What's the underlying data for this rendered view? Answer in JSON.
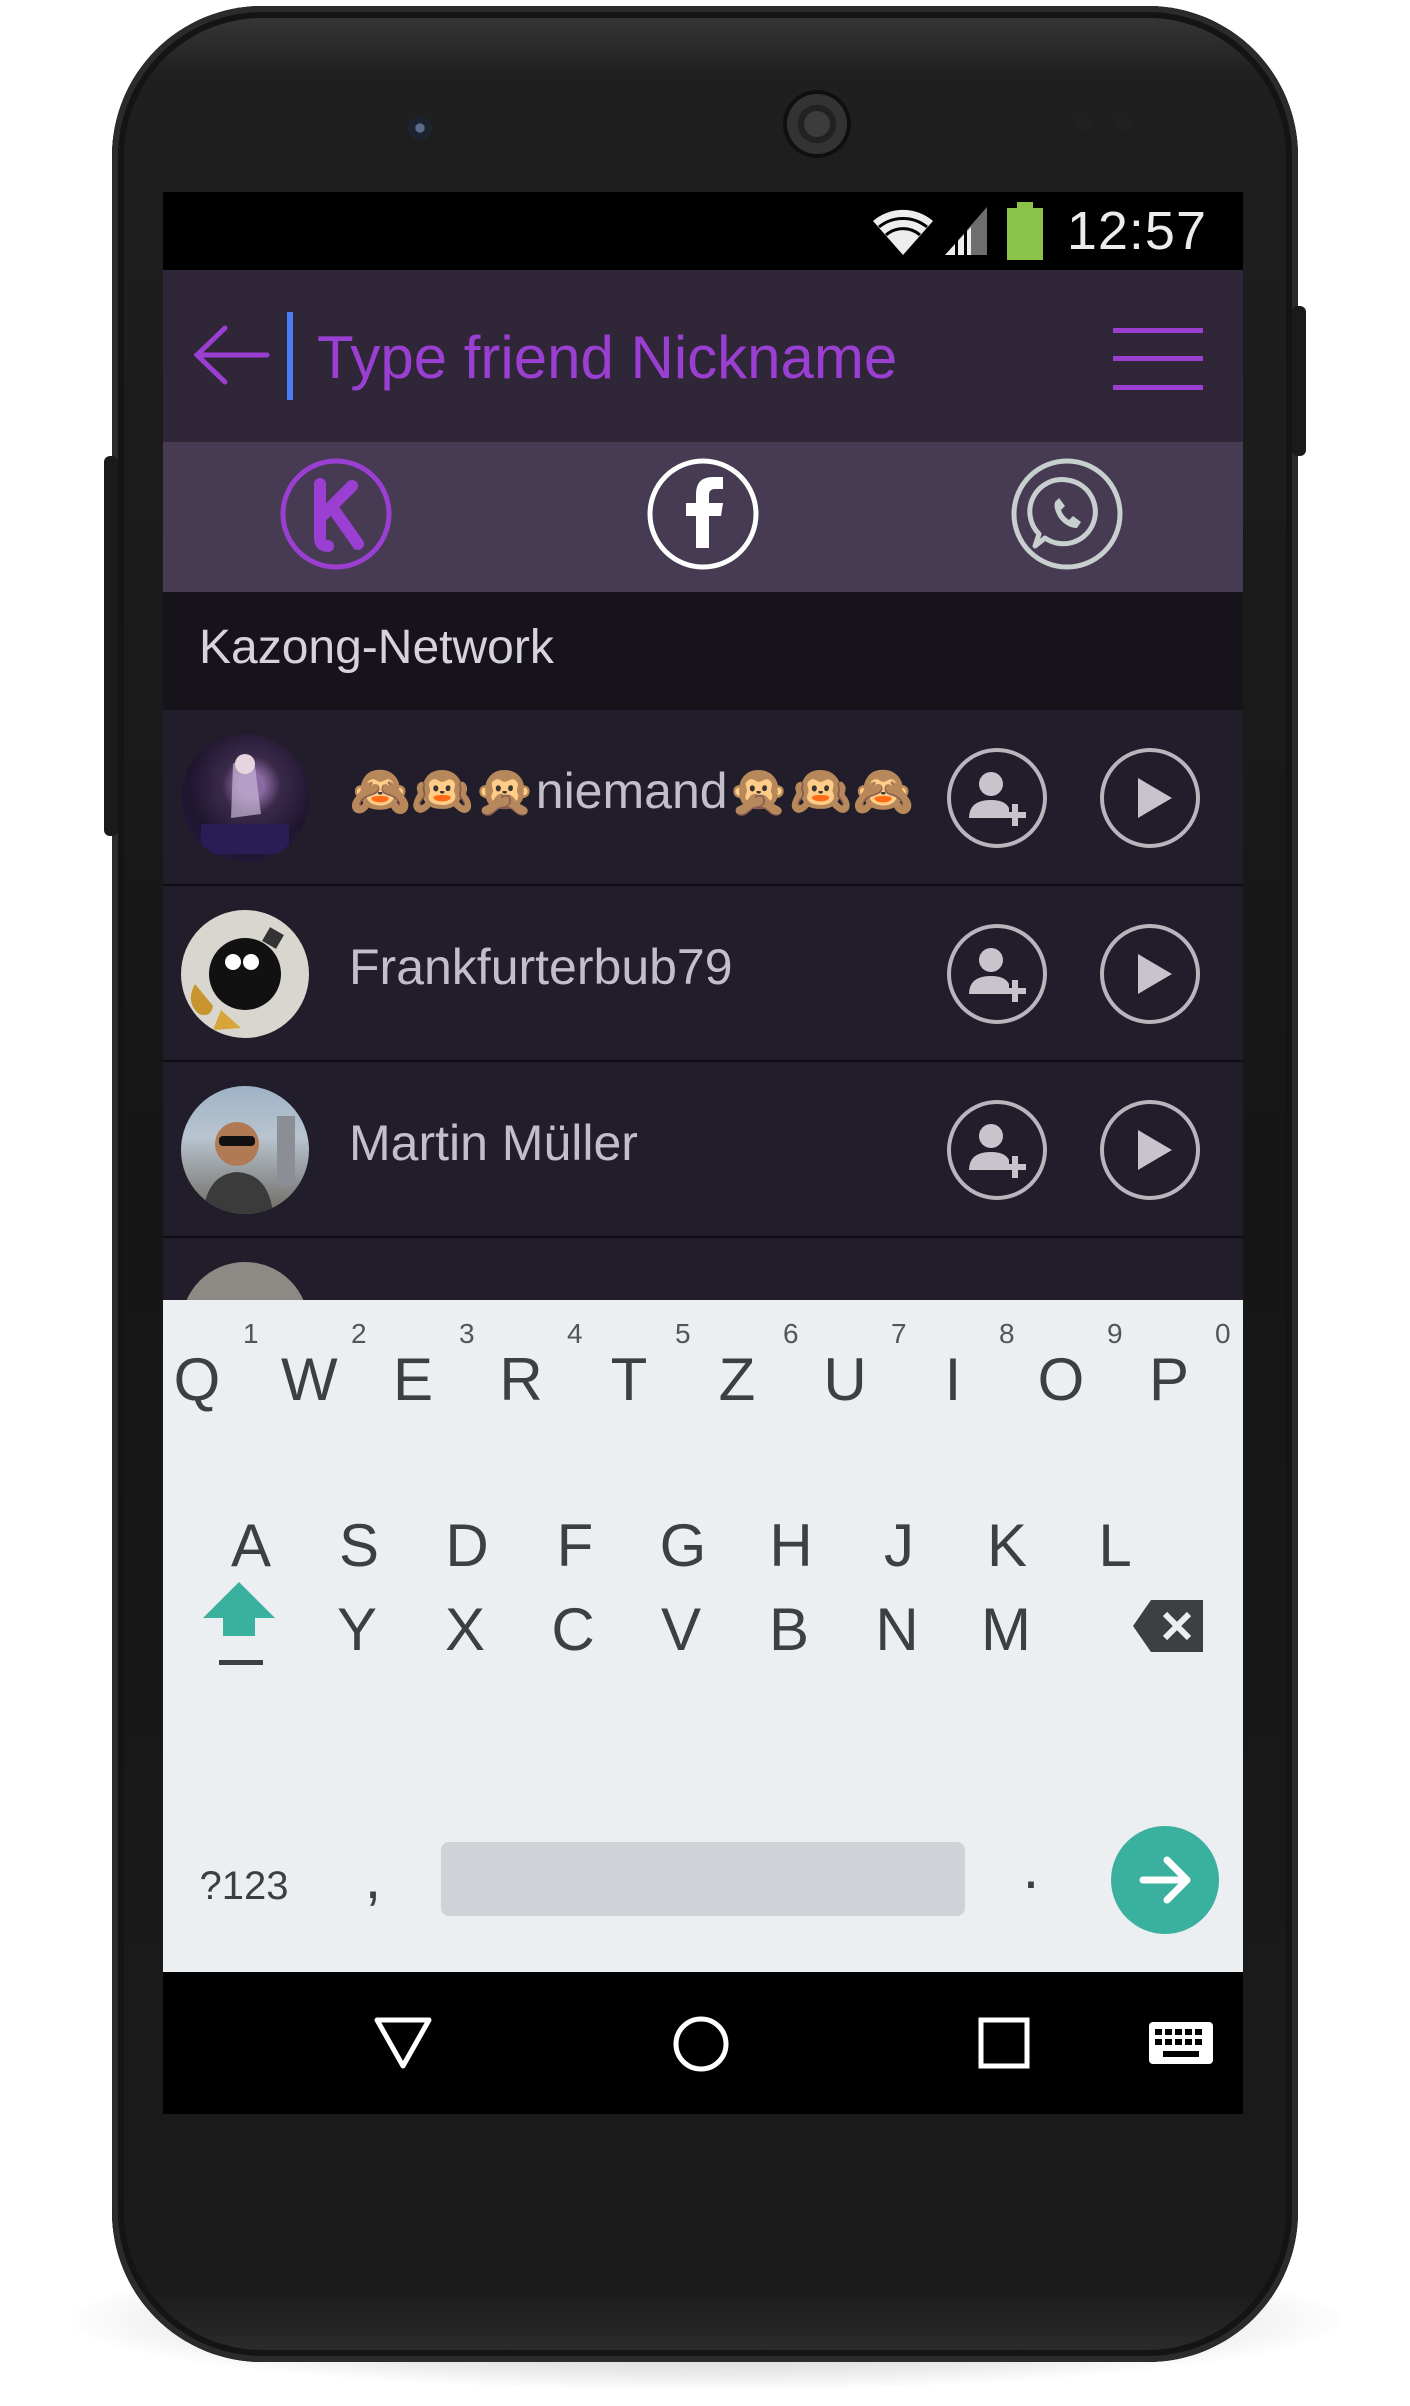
{
  "status_bar": {
    "time": "12:57",
    "icons": [
      "wifi-icon",
      "cell-signal-icon",
      "battery-icon"
    ],
    "battery_color": "#8bc34a"
  },
  "app_bar": {
    "search_placeholder": "Type friend Nickname",
    "accent_color": "#9b3fd3",
    "icons": [
      "back-arrow-icon",
      "hamburger-menu-icon"
    ]
  },
  "networks": [
    {
      "name": "kazong",
      "icon": "kazong-k-icon",
      "selected": true
    },
    {
      "name": "facebook",
      "icon": "facebook-icon",
      "selected": false
    },
    {
      "name": "whatsapp",
      "icon": "whatsapp-icon",
      "selected": false
    }
  ],
  "section": {
    "title": "Kazong-Network"
  },
  "contacts": [
    {
      "name": "🙈🙉🙊niemand🙊🙉🙈",
      "avatar": "gothic-girl-avatar"
    },
    {
      "name": "Frankfurterbub79",
      "avatar": "bomb-character-avatar"
    },
    {
      "name": "Martin Müller",
      "avatar": "man-sunglasses-avatar"
    }
  ],
  "row_actions": {
    "add": "add-friend-icon",
    "play": "play-icon"
  },
  "keyboard": {
    "row1": [
      "Q",
      "W",
      "E",
      "R",
      "T",
      "Z",
      "U",
      "I",
      "O",
      "P"
    ],
    "row1_hints": [
      "1",
      "2",
      "3",
      "4",
      "5",
      "6",
      "7",
      "8",
      "9",
      "0"
    ],
    "row2": [
      "A",
      "S",
      "D",
      "F",
      "G",
      "H",
      "J",
      "K",
      "L"
    ],
    "row3": [
      "Y",
      "X",
      "C",
      "V",
      "B",
      "N",
      "M"
    ],
    "symbols_label": "?123",
    "comma": ",",
    "period": ".",
    "accent_color": "#3ab09e"
  },
  "nav_bar": {
    "icons": [
      "back-triangle-icon",
      "home-circle-icon",
      "recents-square-icon",
      "keyboard-icon"
    ]
  }
}
